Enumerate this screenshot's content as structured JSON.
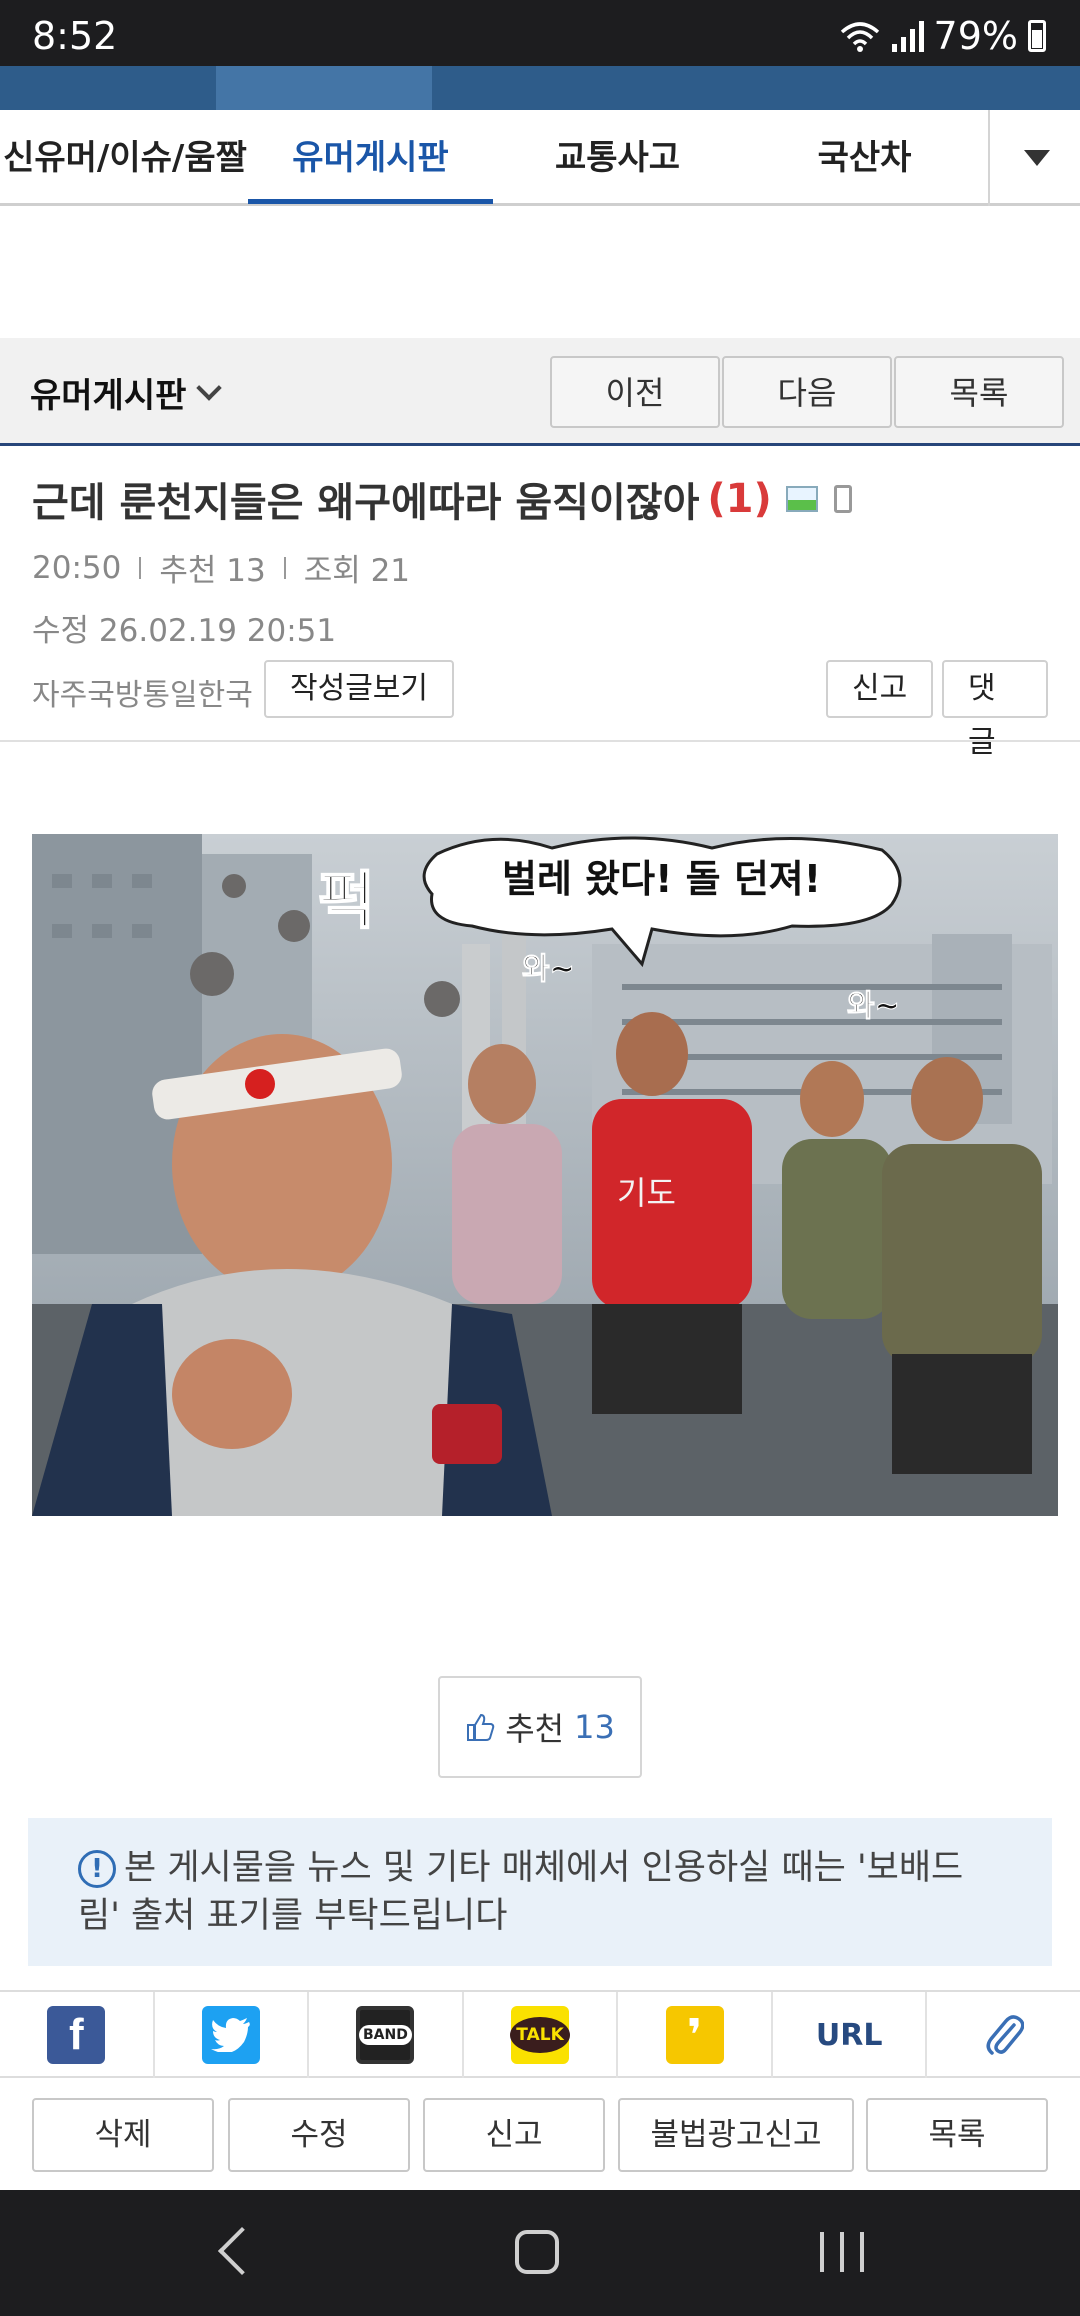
{
  "status": {
    "time": "8:52",
    "battery": "79%"
  },
  "subnav": {
    "items": [
      "신유머/이슈/움짤",
      "유머게시판",
      "교통사고",
      "국산차"
    ],
    "active_index": 1
  },
  "board": {
    "title": "유머게시판",
    "prev_label": "이전",
    "next_label": "다음",
    "list_label": "목록"
  },
  "post": {
    "title": "근데 룬천지들은 왜구에따라 움직이잖아",
    "comment_count": "(1)",
    "time": "20:50",
    "recommend": "추천 13",
    "views": "조회 21",
    "edited": "수정 26.02.19  20:51",
    "author": "자주국방통일한국",
    "view_posts_label": "작성글보기",
    "report_label": "신고",
    "comment_label": "댓글"
  },
  "image": {
    "speech": "벌레 왔다! 돌 던져!",
    "sfx": "퍽",
    "cheer1": "와~",
    "cheer2": "와~",
    "shirt_text": "기도"
  },
  "recommend_box": {
    "label": "추천",
    "count": "13"
  },
  "notice": {
    "icon": "!",
    "text": "본 게시물을 뉴스 및 기타 매체에서 인용하실 때는 '보배드림' 출처 표기를 부탁드립니다"
  },
  "share": {
    "icons": [
      "facebook-icon",
      "twitter-icon",
      "band-icon",
      "kakaotalk-icon",
      "kakaostory-icon",
      "url-link",
      "clip-icon"
    ],
    "band_text": "BAND",
    "talk_text": "TALK",
    "url_text": "URL"
  },
  "actions": {
    "delete": "삭제",
    "edit": "수정",
    "report": "신고",
    "ad_report": "불법광고신고",
    "list": "목록"
  },
  "colors": {
    "brand_blue": "#1a56a8",
    "nav_blue": "#2e5c8a",
    "accent_red": "#d93a3a"
  }
}
